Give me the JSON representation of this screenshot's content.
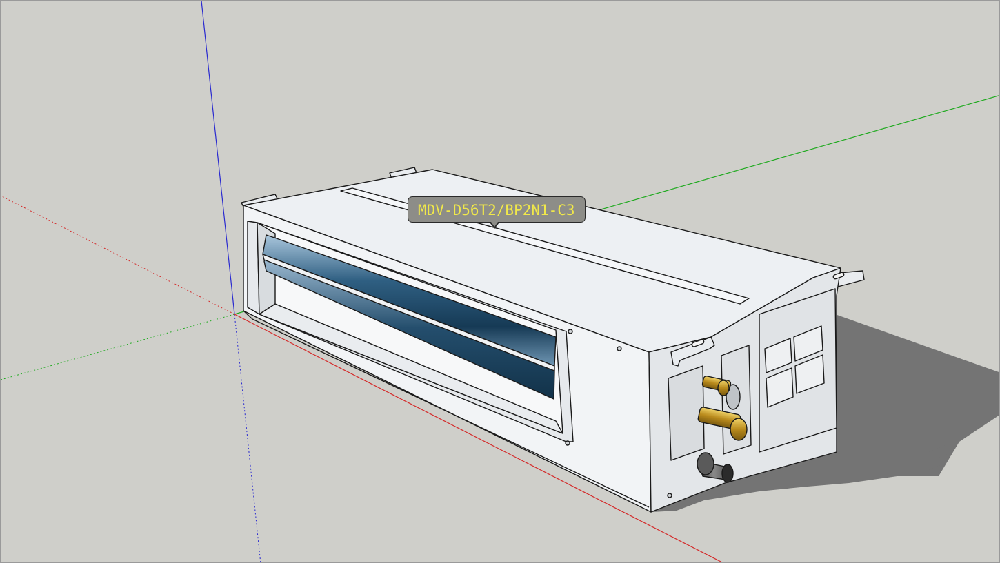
{
  "app": {
    "name": "3D modeling viewport"
  },
  "viewport": {
    "background_color": "#cfcfca",
    "axes": {
      "blue_color": "#2a2ad0",
      "green_color": "#1faa1f",
      "red_color": "#d42a2a"
    }
  },
  "model": {
    "name": "Ducted indoor air-conditioning unit",
    "body_color": "#eef1f4",
    "coil_color": "#2f5f82",
    "fitting_color": "#c9a02a",
    "shadow_color": "#747474"
  },
  "tooltip": {
    "label": "MDV-D56T2/BP2N1-C3",
    "text_color": "#f0e84a",
    "background_color": "#8d8d88"
  }
}
